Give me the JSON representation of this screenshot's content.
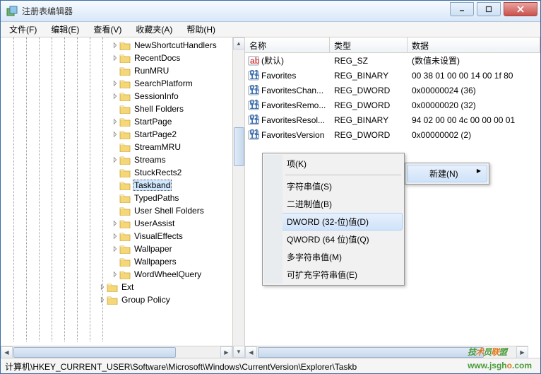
{
  "title": "注册表编辑器",
  "menus": {
    "file": "文件(F)",
    "edit": "编辑(E)",
    "view": "查看(V)",
    "favorites": "收藏夹(A)",
    "help": "帮助(H)"
  },
  "tree_items": [
    {
      "label": "NewShortcutHandlers",
      "sel": false
    },
    {
      "label": "RecentDocs",
      "sel": false
    },
    {
      "label": "RunMRU",
      "sel": false
    },
    {
      "label": "SearchPlatform",
      "sel": false
    },
    {
      "label": "SessionInfo",
      "sel": false
    },
    {
      "label": "Shell Folders",
      "sel": false
    },
    {
      "label": "StartPage",
      "sel": false
    },
    {
      "label": "StartPage2",
      "sel": false
    },
    {
      "label": "StreamMRU",
      "sel": false
    },
    {
      "label": "Streams",
      "sel": false
    },
    {
      "label": "StuckRects2",
      "sel": false
    },
    {
      "label": "Taskband",
      "sel": true
    },
    {
      "label": "TypedPaths",
      "sel": false
    },
    {
      "label": "User Shell Folders",
      "sel": false
    },
    {
      "label": "UserAssist",
      "sel": false
    },
    {
      "label": "VisualEffects",
      "sel": false
    },
    {
      "label": "Wallpaper",
      "sel": false
    },
    {
      "label": "Wallpapers",
      "sel": false
    },
    {
      "label": "WordWheelQuery",
      "sel": false
    }
  ],
  "tree_bottom": [
    {
      "label": "Ext"
    },
    {
      "label": "Group Policy"
    }
  ],
  "columns": {
    "name": "名称",
    "type": "类型",
    "data": "数据"
  },
  "rows": [
    {
      "icon": "str",
      "name": "(默认)",
      "type": "REG_SZ",
      "data": "(数值未设置)"
    },
    {
      "icon": "bin",
      "name": "Favorites",
      "type": "REG_BINARY",
      "data": "00 38 01 00 00 14 00 1f 80"
    },
    {
      "icon": "bin",
      "name": "FavoritesChan...",
      "type": "REG_DWORD",
      "data": "0x00000024 (36)"
    },
    {
      "icon": "bin",
      "name": "FavoritesRemo...",
      "type": "REG_DWORD",
      "data": "0x00000020 (32)"
    },
    {
      "icon": "bin",
      "name": "FavoritesResol...",
      "type": "REG_BINARY",
      "data": "94 02 00 00 4c 00 00 00 01"
    },
    {
      "icon": "bin",
      "name": "FavoritesVersion",
      "type": "REG_DWORD",
      "data": "0x00000002 (2)"
    }
  ],
  "ctx_parent": {
    "new": "新建(N)"
  },
  "ctx_sub": {
    "key": "项(K)",
    "string": "字符串值(S)",
    "binary": "二进制值(B)",
    "dword": "DWORD (32-位)值(D)",
    "qword": "QWORD (64 位)值(Q)",
    "multi": "多字符串值(M)",
    "expand": "可扩充字符串值(E)"
  },
  "statusbar": "计算机\\HKEY_CURRENT_USER\\Software\\Microsoft\\Windows\\CurrentVersion\\Explorer\\Taskb",
  "watermark": {
    "text": "技术员联盟",
    "url_pre": "www.jsgh",
    "url_o": "o",
    "url_post": ".com"
  }
}
